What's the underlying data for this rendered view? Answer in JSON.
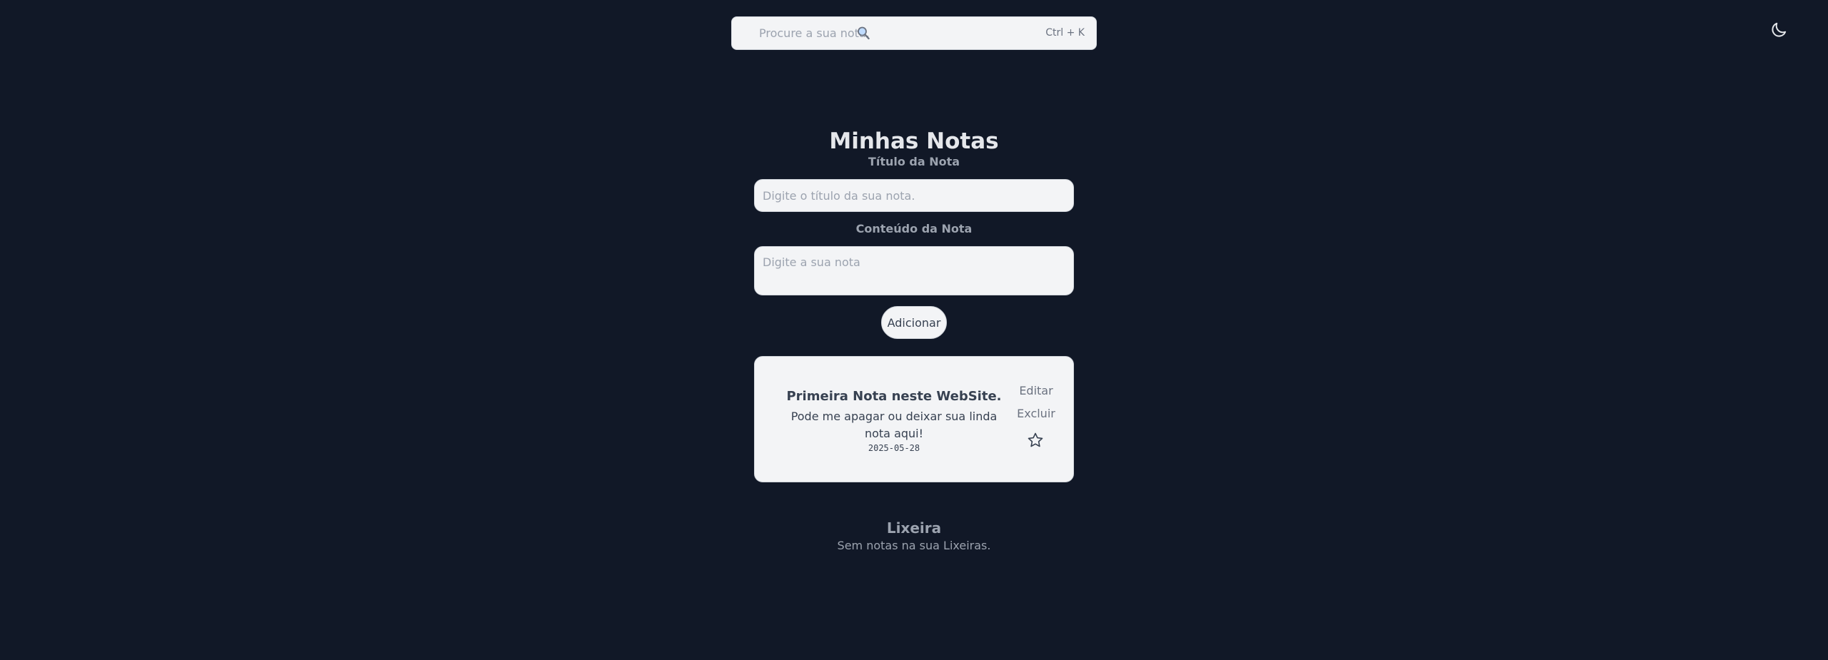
{
  "search": {
    "placeholder": "Procure a sua nota.",
    "shortcut": "Ctrl + K",
    "icon": "search-icon"
  },
  "theme_toggle": {
    "icon": "moon-icon"
  },
  "main": {
    "title": "Minhas Notas",
    "note_title_label": "Título da Nota",
    "note_title_placeholder": "Digite o título da sua nota.",
    "note_content_label": "Conteúdo da Nota",
    "note_content_placeholder": "Digite a sua nota",
    "add_button": "Adicionar"
  },
  "notes": [
    {
      "title": "Primeira Nota neste WebSite.",
      "text": "Pode me apagar ou deixar sua linda nota aqui!",
      "date": "2025-05-28",
      "edit_label": "Editar",
      "delete_label": "Excluir",
      "favorite_icon": "star-icon"
    }
  ],
  "trash": {
    "title": "Lixeira",
    "empty_message": "Sem notas na sua Lixeiras."
  },
  "colors": {
    "background": "#111827",
    "surface": "#f3f4f6",
    "heading": "#e5e7eb",
    "muted": "#9ca3af"
  }
}
